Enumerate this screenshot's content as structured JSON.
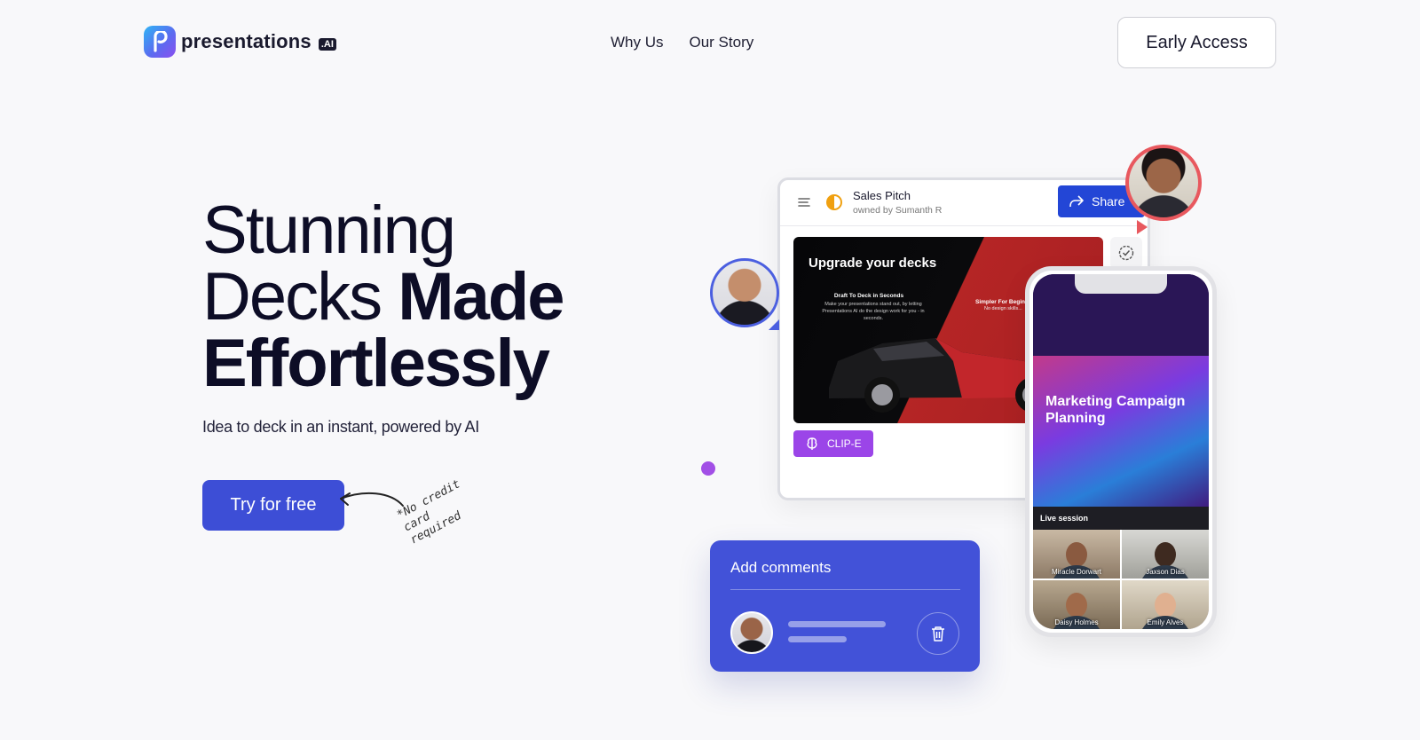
{
  "header": {
    "logo_text": "presentations",
    "logo_badge": ".AI",
    "nav": [
      {
        "label": "Why Us"
      },
      {
        "label": "Our Story"
      }
    ],
    "cta_label": "Early Access"
  },
  "hero": {
    "title_line1": "Stunning",
    "title_line2_light": "Decks",
    "title_line2_bold": "Made",
    "title_line3": "Effortlessly",
    "subtitle": "Idea to deck in an instant, powered by AI",
    "button_label": "Try for free",
    "note": "*No credit card required"
  },
  "illustration": {
    "doc_title": "Sales Pitch",
    "doc_owner": "owned by Sumanth R",
    "share_label": "Share",
    "slide_title": "Upgrade your decks",
    "slide_heading": "Draft To Deck in Seconds",
    "slide_text": "Make your presentations stand out, by letting Presentations AI do the design work for you - in seconds.",
    "slide_heading2": "Simpler For Beginne...",
    "slide_text2": "No design skills...",
    "clip_label": "CLIP-E",
    "phone_title": "Marketing Campaign Planning",
    "live_label": "Live session",
    "participants": [
      "Miracle Dorwart",
      "Jaxson Dias",
      "Daisy Holmes",
      "Emily Alves"
    ],
    "comments_title": "Add comments"
  },
  "icons": {
    "menu": "menu-icon",
    "theme": "half-circle-icon",
    "share": "share-icon",
    "check": "check-circle-icon",
    "clip": "brain-icon",
    "trash": "trash-icon"
  },
  "colors": {
    "primary": "#3d4ed6",
    "share": "#2346d6",
    "clip": "#9b45e8",
    "accent_dot": "#a24fe6"
  }
}
